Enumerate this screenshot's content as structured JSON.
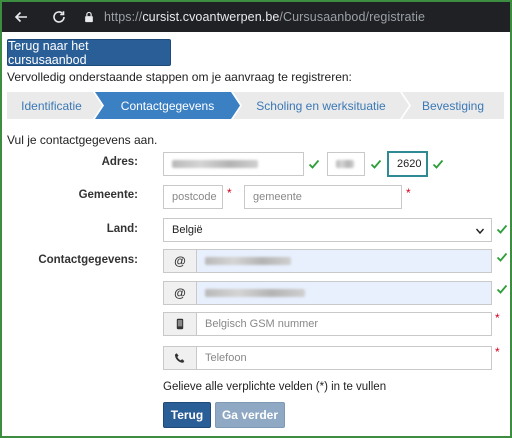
{
  "browser": {
    "url_prefix": "https://",
    "url_host": "cursist.cvoantwerpen.be",
    "url_path": "/Cursusaanbod/registratie"
  },
  "page": {
    "back_top_label": "Terug naar het cursusaanbod",
    "intro": "Vervolledig onderstaande stappen om je aanvraag te registreren:",
    "steps": [
      {
        "label": "Identificatie",
        "active": false
      },
      {
        "label": "Contactgegevens",
        "active": true
      },
      {
        "label": "Scholing en werksituatie",
        "active": false
      },
      {
        "label": "Bevestiging",
        "active": false
      }
    ],
    "subtitle": "Vul je contactgegevens aan.",
    "form": {
      "adres_label": "Adres:",
      "postcode_value": "2620",
      "gemeente_label": "Gemeente:",
      "postcode_placeholder": "postcode",
      "gemeente_placeholder": "gemeente",
      "land_label": "Land:",
      "land_value": "België",
      "contact_label": "Contactgegevens:",
      "email_addon": "@",
      "gsm_placeholder": "Belgisch GSM nummer",
      "telefoon_placeholder": "Telefoon",
      "required_mark": "*"
    },
    "warning": "Gelieve alle verplichte velden (*) in te vullen",
    "buttons": {
      "back": "Terug",
      "next": "Ga verder"
    }
  },
  "colors": {
    "primary": "#2a5e96",
    "step_active": "#3c80c4",
    "check": "#2e9e3a",
    "required": "#d0021b"
  }
}
